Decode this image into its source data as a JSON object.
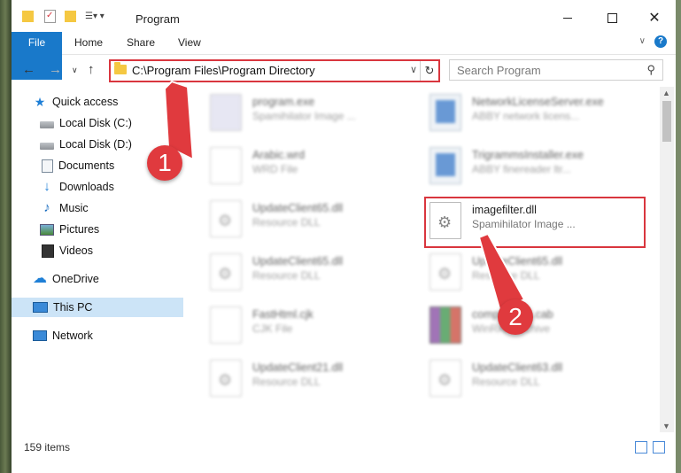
{
  "window": {
    "title": "Program"
  },
  "ribbon": {
    "tabs": [
      "File",
      "Home",
      "Share",
      "View"
    ]
  },
  "address": {
    "path": "C:\\Program Files\\Program Directory"
  },
  "search": {
    "placeholder": "Search Program"
  },
  "sidebar": {
    "items": [
      {
        "label": "Quick access",
        "icon": "star-icon"
      },
      {
        "label": "Local Disk (C:)",
        "icon": "drive-icon"
      },
      {
        "label": "Local Disk (D:)",
        "icon": "drive-icon"
      },
      {
        "label": "Documents",
        "icon": "documents-icon"
      },
      {
        "label": "Downloads",
        "icon": "download-icon"
      },
      {
        "label": "Music",
        "icon": "music-icon"
      },
      {
        "label": "Pictures",
        "icon": "pictures-icon"
      },
      {
        "label": "Videos",
        "icon": "videos-icon"
      },
      {
        "label": "OneDrive",
        "icon": "cloud-icon"
      },
      {
        "label": "This PC",
        "icon": "computer-icon"
      },
      {
        "label": "Network",
        "icon": "network-icon"
      }
    ]
  },
  "files": {
    "left": [
      {
        "name": "program.exe",
        "desc": "Spamihilator Image ..."
      },
      {
        "name": "Arabic.wrd",
        "desc": "WRD File"
      },
      {
        "name": "UpdateClient65.dll",
        "desc": "Resource DLL"
      },
      {
        "name": "UpdateClient65.dll",
        "desc": "Resource DLL"
      },
      {
        "name": "FastHtml.cjk",
        "desc": "CJK File"
      },
      {
        "name": "UpdateClient21.dll",
        "desc": "Resource DLL"
      }
    ],
    "right": [
      {
        "name": "NetworkLicenseServer.exe",
        "desc": "ABBY network licens..."
      },
      {
        "name": "TrigrammsInstaller.exe",
        "desc": "ABBY finereader ltr..."
      },
      {
        "name": "imagefilter.dll",
        "desc": "Spamihilator Image ..."
      },
      {
        "name": "UpdateClient65.dll",
        "desc": "Resource DLL"
      },
      {
        "name": "components.cab",
        "desc": "WinRAR archive"
      },
      {
        "name": "UpdateClient63.dll",
        "desc": "Resource DLL"
      }
    ]
  },
  "status": {
    "count": "159 items"
  },
  "callouts": {
    "one": "1",
    "two": "2"
  },
  "colors": {
    "accent": "#1979ca",
    "highlight": "#d9363e",
    "badge": "#e03a3e",
    "selected": "#cce4f7"
  }
}
